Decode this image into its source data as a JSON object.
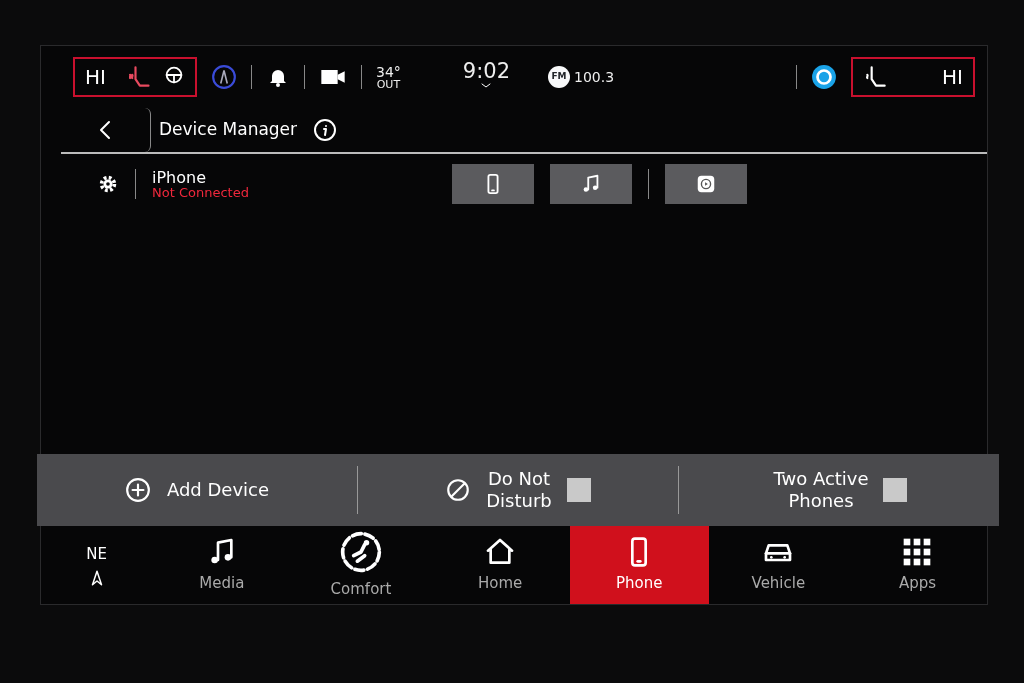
{
  "status_bar": {
    "driver_seat": {
      "label": "HI"
    },
    "temperature": "34°",
    "temperature_label": "OUT",
    "time": "9:02",
    "radio": {
      "band": "FM",
      "station": "100.3"
    },
    "passenger_seat": {
      "label": "HI"
    }
  },
  "header": {
    "title": "Device Manager"
  },
  "devices": [
    {
      "name": "iPhone",
      "status": "Not Connected"
    }
  ],
  "actions": [
    {
      "kind": "button",
      "label": "Add Device"
    },
    {
      "kind": "checkbox",
      "label": "Do Not Disturb",
      "checked": false
    },
    {
      "kind": "checkbox",
      "label": "Two Active Phones",
      "checked": false
    }
  ],
  "compass": {
    "heading": "NE"
  },
  "nav": [
    {
      "kind": "media",
      "label": "Media",
      "selected": false
    },
    {
      "kind": "comfort",
      "label": "Comfort",
      "selected": false
    },
    {
      "kind": "home",
      "label": "Home",
      "selected": false
    },
    {
      "kind": "phone",
      "label": "Phone",
      "selected": true
    },
    {
      "kind": "vehicle",
      "label": "Vehicle",
      "selected": false
    },
    {
      "kind": "apps",
      "label": "Apps",
      "selected": false
    }
  ]
}
